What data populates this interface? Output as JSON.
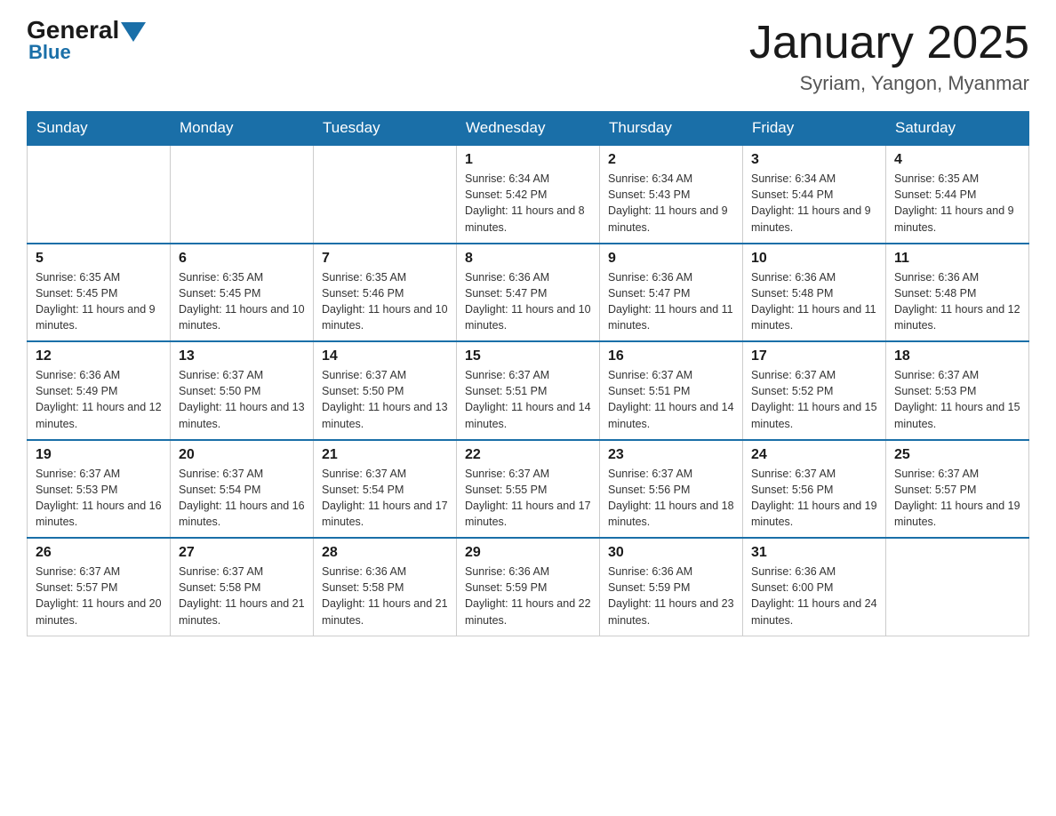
{
  "logo": {
    "general": "General",
    "blue": "Blue"
  },
  "title": {
    "month_year": "January 2025",
    "location": "Syriam, Yangon, Myanmar"
  },
  "days_of_week": [
    "Sunday",
    "Monday",
    "Tuesday",
    "Wednesday",
    "Thursday",
    "Friday",
    "Saturday"
  ],
  "weeks": [
    [
      {
        "day": "",
        "info": ""
      },
      {
        "day": "",
        "info": ""
      },
      {
        "day": "",
        "info": ""
      },
      {
        "day": "1",
        "info": "Sunrise: 6:34 AM\nSunset: 5:42 PM\nDaylight: 11 hours and 8 minutes."
      },
      {
        "day": "2",
        "info": "Sunrise: 6:34 AM\nSunset: 5:43 PM\nDaylight: 11 hours and 9 minutes."
      },
      {
        "day": "3",
        "info": "Sunrise: 6:34 AM\nSunset: 5:44 PM\nDaylight: 11 hours and 9 minutes."
      },
      {
        "day": "4",
        "info": "Sunrise: 6:35 AM\nSunset: 5:44 PM\nDaylight: 11 hours and 9 minutes."
      }
    ],
    [
      {
        "day": "5",
        "info": "Sunrise: 6:35 AM\nSunset: 5:45 PM\nDaylight: 11 hours and 9 minutes."
      },
      {
        "day": "6",
        "info": "Sunrise: 6:35 AM\nSunset: 5:45 PM\nDaylight: 11 hours and 10 minutes."
      },
      {
        "day": "7",
        "info": "Sunrise: 6:35 AM\nSunset: 5:46 PM\nDaylight: 11 hours and 10 minutes."
      },
      {
        "day": "8",
        "info": "Sunrise: 6:36 AM\nSunset: 5:47 PM\nDaylight: 11 hours and 10 minutes."
      },
      {
        "day": "9",
        "info": "Sunrise: 6:36 AM\nSunset: 5:47 PM\nDaylight: 11 hours and 11 minutes."
      },
      {
        "day": "10",
        "info": "Sunrise: 6:36 AM\nSunset: 5:48 PM\nDaylight: 11 hours and 11 minutes."
      },
      {
        "day": "11",
        "info": "Sunrise: 6:36 AM\nSunset: 5:48 PM\nDaylight: 11 hours and 12 minutes."
      }
    ],
    [
      {
        "day": "12",
        "info": "Sunrise: 6:36 AM\nSunset: 5:49 PM\nDaylight: 11 hours and 12 minutes."
      },
      {
        "day": "13",
        "info": "Sunrise: 6:37 AM\nSunset: 5:50 PM\nDaylight: 11 hours and 13 minutes."
      },
      {
        "day": "14",
        "info": "Sunrise: 6:37 AM\nSunset: 5:50 PM\nDaylight: 11 hours and 13 minutes."
      },
      {
        "day": "15",
        "info": "Sunrise: 6:37 AM\nSunset: 5:51 PM\nDaylight: 11 hours and 14 minutes."
      },
      {
        "day": "16",
        "info": "Sunrise: 6:37 AM\nSunset: 5:51 PM\nDaylight: 11 hours and 14 minutes."
      },
      {
        "day": "17",
        "info": "Sunrise: 6:37 AM\nSunset: 5:52 PM\nDaylight: 11 hours and 15 minutes."
      },
      {
        "day": "18",
        "info": "Sunrise: 6:37 AM\nSunset: 5:53 PM\nDaylight: 11 hours and 15 minutes."
      }
    ],
    [
      {
        "day": "19",
        "info": "Sunrise: 6:37 AM\nSunset: 5:53 PM\nDaylight: 11 hours and 16 minutes."
      },
      {
        "day": "20",
        "info": "Sunrise: 6:37 AM\nSunset: 5:54 PM\nDaylight: 11 hours and 16 minutes."
      },
      {
        "day": "21",
        "info": "Sunrise: 6:37 AM\nSunset: 5:54 PM\nDaylight: 11 hours and 17 minutes."
      },
      {
        "day": "22",
        "info": "Sunrise: 6:37 AM\nSunset: 5:55 PM\nDaylight: 11 hours and 17 minutes."
      },
      {
        "day": "23",
        "info": "Sunrise: 6:37 AM\nSunset: 5:56 PM\nDaylight: 11 hours and 18 minutes."
      },
      {
        "day": "24",
        "info": "Sunrise: 6:37 AM\nSunset: 5:56 PM\nDaylight: 11 hours and 19 minutes."
      },
      {
        "day": "25",
        "info": "Sunrise: 6:37 AM\nSunset: 5:57 PM\nDaylight: 11 hours and 19 minutes."
      }
    ],
    [
      {
        "day": "26",
        "info": "Sunrise: 6:37 AM\nSunset: 5:57 PM\nDaylight: 11 hours and 20 minutes."
      },
      {
        "day": "27",
        "info": "Sunrise: 6:37 AM\nSunset: 5:58 PM\nDaylight: 11 hours and 21 minutes."
      },
      {
        "day": "28",
        "info": "Sunrise: 6:36 AM\nSunset: 5:58 PM\nDaylight: 11 hours and 21 minutes."
      },
      {
        "day": "29",
        "info": "Sunrise: 6:36 AM\nSunset: 5:59 PM\nDaylight: 11 hours and 22 minutes."
      },
      {
        "day": "30",
        "info": "Sunrise: 6:36 AM\nSunset: 5:59 PM\nDaylight: 11 hours and 23 minutes."
      },
      {
        "day": "31",
        "info": "Sunrise: 6:36 AM\nSunset: 6:00 PM\nDaylight: 11 hours and 24 minutes."
      },
      {
        "day": "",
        "info": ""
      }
    ]
  ]
}
